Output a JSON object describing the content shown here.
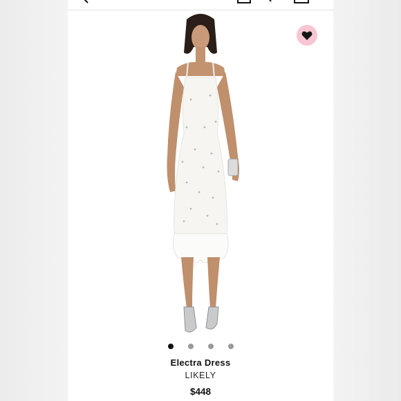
{
  "header": {
    "icons": [
      "back-arrow-icon",
      "account-icon",
      "search-icon",
      "shopping-bag-icon"
    ]
  },
  "favorite": {
    "icon": "heart-icon",
    "color": "#f7c6d2"
  },
  "gallery": {
    "image_count": 4,
    "active_index": 0
  },
  "product": {
    "name": "Electra Dress",
    "brand": "LIKELY",
    "price": "$448"
  }
}
